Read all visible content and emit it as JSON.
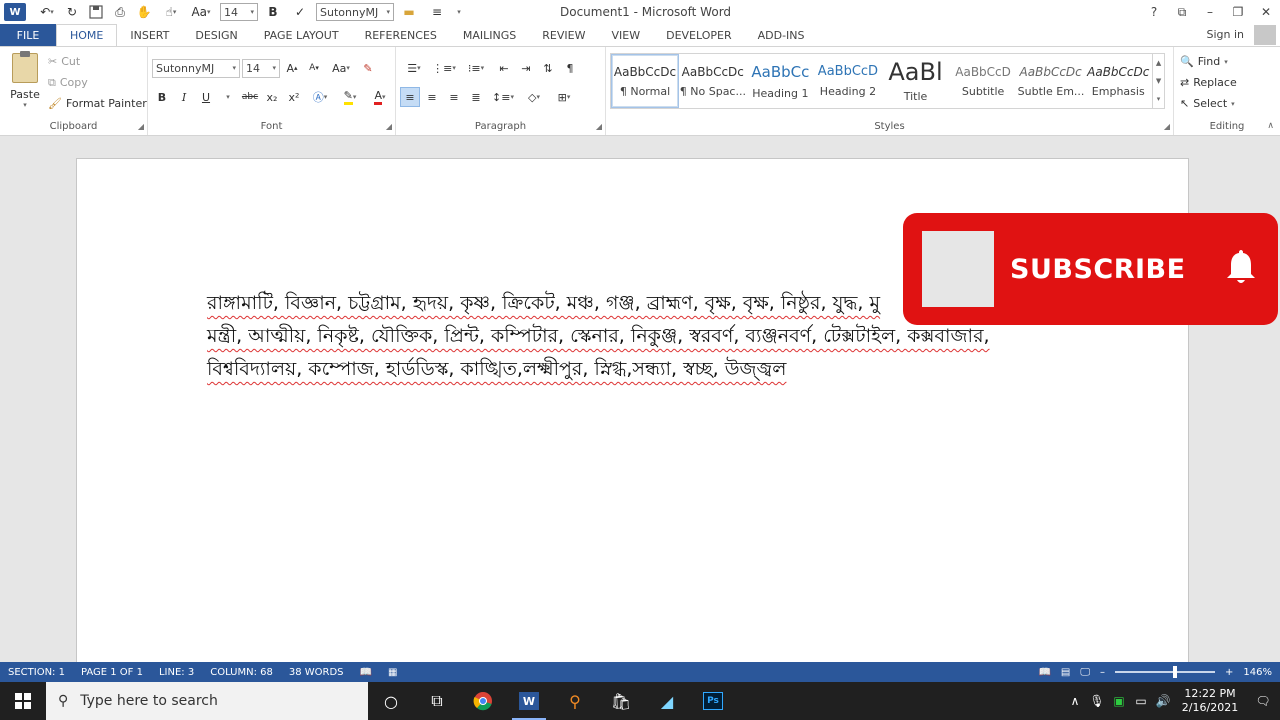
{
  "titlebar": {
    "title": "Document1 - Microsoft Word",
    "font_size": "14",
    "font_name": "SutonnyMJ",
    "aa": "Aa",
    "help": "?",
    "restore_ribbon": "⧉",
    "minimize": "–",
    "maximize": "❐",
    "close": "✕"
  },
  "tabs": [
    "FILE",
    "HOME",
    "INSERT",
    "DESIGN",
    "PAGE LAYOUT",
    "REFERENCES",
    "MAILINGS",
    "REVIEW",
    "VIEW",
    "DEVELOPER",
    "ADD-INS"
  ],
  "signin": "Sign in",
  "clipboard": {
    "paste": "Paste",
    "cut": "Cut",
    "copy": "Copy",
    "format_painter": "Format Painter",
    "label": "Clipboard"
  },
  "font": {
    "name": "SutonnyMJ",
    "size": "14",
    "label": "Font",
    "bold": "B",
    "italic": "I",
    "underline": "U",
    "strike": "abc",
    "subscript": "x₂",
    "superscript": "x²",
    "grow": "A",
    "shrink": "A",
    "change_case": "Aa"
  },
  "paragraph": {
    "label": "Paragraph",
    "pilcrow": "¶"
  },
  "styles": {
    "label": "Styles",
    "items": [
      {
        "preview": "AaBbCcDc",
        "name": "¶ Normal"
      },
      {
        "preview": "AaBbCcDc",
        "name": "¶ No Spac..."
      },
      {
        "preview": "AaBbCc",
        "name": "Heading 1"
      },
      {
        "preview": "AaBbCcD",
        "name": "Heading 2"
      },
      {
        "preview": "AaBl",
        "name": "Title"
      },
      {
        "preview": "AaBbCcD",
        "name": "Subtitle"
      },
      {
        "preview": "AaBbCcDc",
        "name": "Subtle Em..."
      },
      {
        "preview": "AaBbCcDc",
        "name": "Emphasis"
      }
    ]
  },
  "editing": {
    "label": "Editing",
    "find": "Find",
    "replace": "Replace",
    "select": "Select"
  },
  "document": {
    "lines": [
      "রাঙ্গামাটি, বিজ্ঞান, চট্টগ্রাম, হৃদয়, কৃষ্ণ, ক্রিকেট, মঞ্চ, গঞ্জ, ব্রাহ্মণ, বৃক্ষ, বৃক্ষ, নিষ্ঠুর, যুদ্ধ, মু",
      "মন্ত্রী, আত্মীয়, নিকৃষ্ট, যৌক্তিক, প্রিন্ট, কম্পিটার, স্কেনার, নিকুঞ্জ, স্বরবর্ণ, ব্যঞ্জনবর্ণ, টেক্সটাইল, কক্সবাজার,",
      "বিশ্ববিদ্যালয়, কম্পোজ, হার্ডডিস্ক, কাঙ্খিত,লক্ষ্মীপুর, স্নিগ্ধ,সন্ধ্যা, স্বচ্ছ, উজ্জ্বল"
    ]
  },
  "subscribe": {
    "text": "SUBSCRIBE"
  },
  "status": {
    "section": "SECTION: 1",
    "page": "PAGE 1 OF 1",
    "line": "LINE: 3",
    "column": "COLUMN: 68",
    "words": "38 WORDS",
    "zoom": "146%"
  },
  "taskbar": {
    "search_placeholder": "Type here to search",
    "time": "12:22 PM",
    "date": "2/16/2021",
    "word_label": "W",
    "ps_label": "Ps"
  },
  "colors": {
    "accent": "#2b579a",
    "subscribe_red": "#e01212",
    "taskbar": "#202020"
  }
}
